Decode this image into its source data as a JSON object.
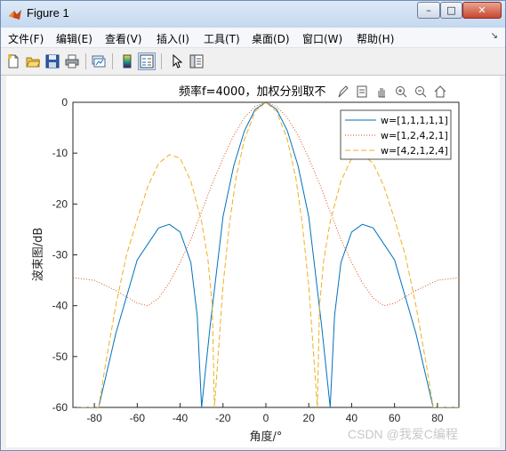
{
  "window": {
    "title": "Figure 1",
    "controls": {
      "minimize": "–",
      "maximize": "□",
      "close": "✕"
    }
  },
  "menubar": {
    "items": [
      {
        "label": "文件(F)",
        "name": "menu-file"
      },
      {
        "label": "编辑(E)",
        "name": "menu-edit"
      },
      {
        "label": "查看(V)",
        "name": "menu-view"
      },
      {
        "label": "插入(I)",
        "name": "menu-insert"
      },
      {
        "label": "工具(T)",
        "name": "menu-tools"
      },
      {
        "label": "桌面(D)",
        "name": "menu-desktop"
      },
      {
        "label": "窗口(W)",
        "name": "menu-window"
      },
      {
        "label": "帮助(H)",
        "name": "menu-help"
      }
    ]
  },
  "toolbar": {
    "buttons": [
      "new-figure-icon",
      "open-folder-icon",
      "save-icon",
      "print-icon",
      "link-plot-icon",
      "colorbar-icon",
      "legend-icon",
      "pointer-icon",
      "property-editor-icon"
    ]
  },
  "axes_toolbar": {
    "buttons": [
      "brush-icon",
      "data-tips-icon",
      "pan-icon",
      "zoom-in-icon",
      "zoom-out-icon",
      "home-icon"
    ]
  },
  "watermark": "CSDN @我爱C编程",
  "colors": {
    "series1": "#0072bd",
    "series2": "#d95319",
    "series3": "#edb120",
    "axis": "#262626",
    "titlebar": "#c4d8ef"
  },
  "chart_data": {
    "type": "line",
    "title": "频率f=4000，加权分别取不",
    "xlabel": "角度/°",
    "ylabel": "波束图/dB",
    "xlim": [
      -90,
      90
    ],
    "ylim": [
      -60,
      0
    ],
    "xticks": [
      -80,
      -60,
      -40,
      -20,
      0,
      20,
      40,
      60,
      80
    ],
    "yticks": [
      0,
      -10,
      -20,
      -30,
      -40,
      -50,
      -60
    ],
    "grid": false,
    "legend_position": "top-right",
    "series": [
      {
        "name": "w=[1,1,1,1,1]",
        "style": "solid",
        "x": [
          -90,
          -78,
          -70,
          -60,
          -50,
          -45,
          -40,
          -35,
          -32,
          -30,
          -26,
          -20,
          -15,
          -10,
          -5,
          0,
          5,
          10,
          15,
          20,
          26,
          30,
          32,
          35,
          40,
          45,
          50,
          60,
          70,
          78,
          90
        ],
        "y": [
          -60,
          -60,
          -45.5,
          -31,
          -24.7,
          -24,
          -25.5,
          -31.5,
          -42,
          -60,
          -44,
          -22.5,
          -12.5,
          -5.6,
          -1.4,
          0,
          -1.4,
          -5.6,
          -12.5,
          -22.5,
          -44,
          -60,
          -42,
          -31.5,
          -25.5,
          -24,
          -24.7,
          -31,
          -45.5,
          -60,
          -60
        ]
      },
      {
        "name": "w=[1,2,4,2,1]",
        "style": "dotted",
        "x": [
          -90,
          -80,
          -70,
          -60,
          -55,
          -50,
          -45,
          -40,
          -35,
          -30,
          -25,
          -20,
          -15,
          -10,
          -5,
          0,
          5,
          10,
          15,
          20,
          25,
          30,
          35,
          40,
          45,
          50,
          55,
          60,
          70,
          80,
          90
        ],
        "y": [
          -34.5,
          -35,
          -37,
          -39.5,
          -40,
          -38.5,
          -35.5,
          -31.5,
          -27,
          -21.5,
          -16,
          -11,
          -6.5,
          -3,
          -0.8,
          0,
          -0.8,
          -3,
          -6.5,
          -11,
          -16,
          -21.5,
          -27,
          -31.5,
          -35.5,
          -38.5,
          -40,
          -39.5,
          -37,
          -35,
          -34.5
        ]
      },
      {
        "name": "w=[4,2,1,2,4]",
        "style": "dashed",
        "x": [
          -90,
          -78,
          -75,
          -70,
          -65,
          -60,
          -55,
          -50,
          -45,
          -40,
          -35,
          -30,
          -27,
          -25,
          -24,
          -22,
          -20,
          -17,
          -14,
          -10,
          -5,
          0,
          5,
          10,
          14,
          17,
          20,
          22,
          24,
          25,
          27,
          30,
          35,
          40,
          45,
          50,
          55,
          60,
          65,
          70,
          75,
          78,
          90
        ],
        "y": [
          -60,
          -60,
          -52,
          -40,
          -30,
          -23,
          -16.5,
          -12,
          -10.3,
          -11,
          -15.5,
          -23.5,
          -31,
          -40,
          -60,
          -48,
          -36,
          -24,
          -15,
          -7.3,
          -1.8,
          0,
          -1.8,
          -7.3,
          -15,
          -24,
          -36,
          -48,
          -60,
          -40,
          -31,
          -23.5,
          -15.5,
          -11,
          -10.3,
          -12,
          -16.5,
          -23,
          -30,
          -40,
          -52,
          -60,
          -60
        ]
      }
    ]
  }
}
